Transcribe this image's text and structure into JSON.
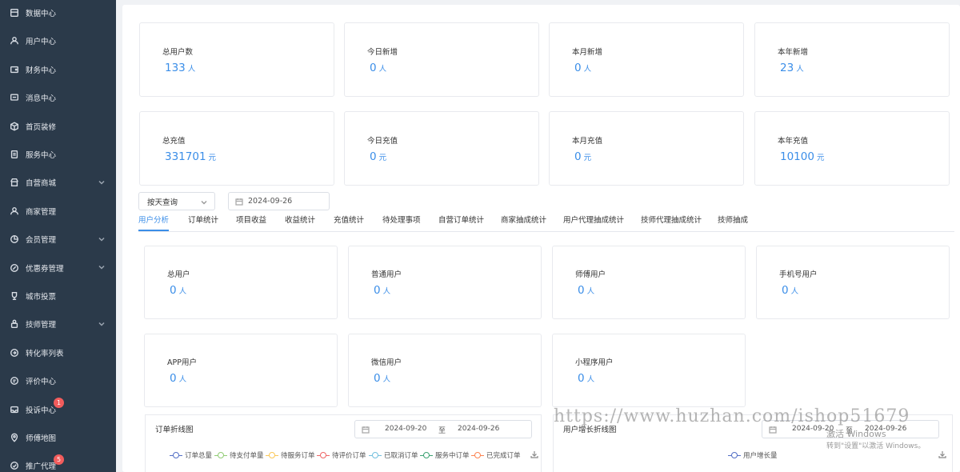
{
  "sidebar": {
    "items": [
      {
        "label": "数据中心",
        "icon": "dashboard-icon"
      },
      {
        "label": "用户中心",
        "icon": "user-icon"
      },
      {
        "label": "财务中心",
        "icon": "wallet-icon"
      },
      {
        "label": "消息中心",
        "icon": "message-icon"
      },
      {
        "label": "首页装修",
        "icon": "cube-icon"
      },
      {
        "label": "服务中心",
        "icon": "clipboard-icon"
      },
      {
        "label": "自营商城",
        "icon": "shop-icon",
        "expandable": true
      },
      {
        "label": "商家管理",
        "icon": "merchant-icon"
      },
      {
        "label": "会员管理",
        "icon": "member-icon",
        "expandable": true
      },
      {
        "label": "优惠券管理",
        "icon": "coupon-icon",
        "expandable": true
      },
      {
        "label": "城市投票",
        "icon": "trophy-icon"
      },
      {
        "label": "技师管理",
        "icon": "technician-icon",
        "expandable": true
      },
      {
        "label": "转化率列表",
        "icon": "conversion-icon"
      },
      {
        "label": "评价中心",
        "icon": "review-icon"
      },
      {
        "label": "投诉中心",
        "icon": "complaint-icon",
        "badge": "1"
      },
      {
        "label": "师傅地图",
        "icon": "map-pin-icon"
      },
      {
        "label": "推广代理",
        "icon": "promotion-icon",
        "badge": "5"
      }
    ]
  },
  "stats_users": [
    {
      "label": "总用户数",
      "value": "133",
      "unit": "人"
    },
    {
      "label": "今日新增",
      "value": "0",
      "unit": "人"
    },
    {
      "label": "本月新增",
      "value": "0",
      "unit": "人"
    },
    {
      "label": "本年新增",
      "value": "23",
      "unit": "人"
    }
  ],
  "stats_recharge": [
    {
      "label": "总充值",
      "value": "331701",
      "unit": "元"
    },
    {
      "label": "今日充值",
      "value": "0",
      "unit": "元"
    },
    {
      "label": "本月充值",
      "value": "0",
      "unit": "元"
    },
    {
      "label": "本年充值",
      "value": "10100",
      "unit": "元"
    }
  ],
  "filter": {
    "mode_value": "按天查询",
    "date_value": "2024-09-26"
  },
  "tabs": [
    "用户分析",
    "订单统计",
    "项目收益",
    "收益统计",
    "充值统计",
    "待处理事项",
    "自营订单统计",
    "商家抽成统计",
    "用户代理抽成统计",
    "技师代理抽成统计",
    "技师抽成"
  ],
  "active_tab": "用户分析",
  "user_types_row1": [
    {
      "label": "总用户",
      "value": "0",
      "unit": "人"
    },
    {
      "label": "普通用户",
      "value": "0",
      "unit": "人"
    },
    {
      "label": "师傅用户",
      "value": "0",
      "unit": "人"
    },
    {
      "label": "手机号用户",
      "value": "0",
      "unit": "人"
    }
  ],
  "user_types_row2": [
    {
      "label": "APP用户",
      "value": "0",
      "unit": "人"
    },
    {
      "label": "微信用户",
      "value": "0",
      "unit": "人"
    },
    {
      "label": "小程序用户",
      "value": "0",
      "unit": "人"
    }
  ],
  "order_chart": {
    "title": "订单折线图",
    "range_start": "2024-09-20",
    "range_sep": "至",
    "range_end": "2024-09-26",
    "legend": [
      {
        "name": "订单总量",
        "color": "#5470c6"
      },
      {
        "name": "待支付单量",
        "color": "#91cc75"
      },
      {
        "name": "待服务订单",
        "color": "#fac858"
      },
      {
        "name": "待评价订单",
        "color": "#ee6666"
      },
      {
        "name": "已取消订单",
        "color": "#73c0de"
      },
      {
        "name": "服务中订单",
        "color": "#3ba272"
      },
      {
        "name": "已完成订单",
        "color": "#fc8452"
      }
    ]
  },
  "user_chart": {
    "title": "用户增长折线图",
    "range_start": "2024-09-20",
    "range_sep": "至",
    "range_end": "2024-09-26",
    "legend": [
      {
        "name": "用户增长量",
        "color": "#5470c6"
      }
    ]
  },
  "watermark": {
    "text": "https://www.huzhan.com/ishop51679",
    "activate_title": "激活 Windows",
    "activate_sub": "转到\"设置\"以激活 Windows。"
  }
}
